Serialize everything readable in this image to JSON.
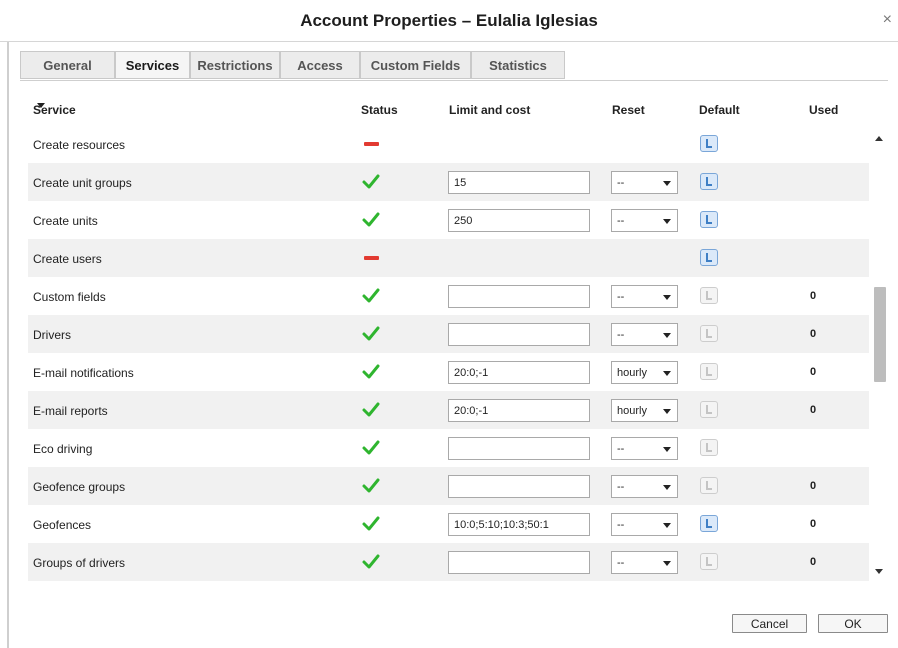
{
  "window": {
    "title": "Account Properties – Eulalia Iglesias",
    "close_glyph": "×"
  },
  "tabs": [
    {
      "label": "General",
      "active": false
    },
    {
      "label": "Services",
      "active": true
    },
    {
      "label": "Restrictions",
      "active": false
    },
    {
      "label": "Access",
      "active": false
    },
    {
      "label": "Custom Fields",
      "active": false
    },
    {
      "label": "Statistics",
      "active": false
    }
  ],
  "table": {
    "columns": {
      "service": "Service",
      "status": "Status",
      "limit": "Limit and cost",
      "reset": "Reset",
      "default": "Default",
      "used": "Used"
    },
    "sort_icon": "sort-desc-caret-icon",
    "rows": [
      {
        "service": "Create resources",
        "status": "disabled",
        "limit": null,
        "reset": null,
        "default_on": true,
        "used": ""
      },
      {
        "service": "Create unit groups",
        "status": "enabled",
        "limit": "15",
        "reset": "--",
        "default_on": true,
        "used": ""
      },
      {
        "service": "Create units",
        "status": "enabled",
        "limit": "250",
        "reset": "--",
        "default_on": true,
        "used": ""
      },
      {
        "service": "Create users",
        "status": "disabled",
        "limit": null,
        "reset": null,
        "default_on": true,
        "used": ""
      },
      {
        "service": "Custom fields",
        "status": "enabled",
        "limit": "",
        "reset": "--",
        "default_on": false,
        "used": "0"
      },
      {
        "service": "Drivers",
        "status": "enabled",
        "limit": "",
        "reset": "--",
        "default_on": false,
        "used": "0"
      },
      {
        "service": "E-mail notifications",
        "status": "enabled",
        "limit": "20:0;-1",
        "reset": "hourly",
        "default_on": false,
        "used": "0"
      },
      {
        "service": "E-mail reports",
        "status": "enabled",
        "limit": "20:0;-1",
        "reset": "hourly",
        "default_on": false,
        "used": "0"
      },
      {
        "service": "Eco driving",
        "status": "enabled",
        "limit": "",
        "reset": "--",
        "default_on": false,
        "used": ""
      },
      {
        "service": "Geofence groups",
        "status": "enabled",
        "limit": "",
        "reset": "--",
        "default_on": false,
        "used": "0"
      },
      {
        "service": "Geofences",
        "status": "enabled",
        "limit": "10:0;5:10;10:3;50:1",
        "reset": "--",
        "default_on": true,
        "used": "0"
      },
      {
        "service": "Groups of drivers",
        "status": "enabled",
        "limit": "",
        "reset": "--",
        "default_on": false,
        "used": "0"
      }
    ]
  },
  "icons": {
    "enabled": "checkmark-icon",
    "disabled": "minus-icon",
    "default": "default-info-icon",
    "dropdown": "chevron-down-icon"
  },
  "colors": {
    "check": "#2fb52f",
    "minus": "#e23a31",
    "default_on": "#3f7fc5",
    "row_alt": "#f1f1f1"
  },
  "footer": {
    "cancel_label": "Cancel",
    "ok_label": "OK"
  }
}
